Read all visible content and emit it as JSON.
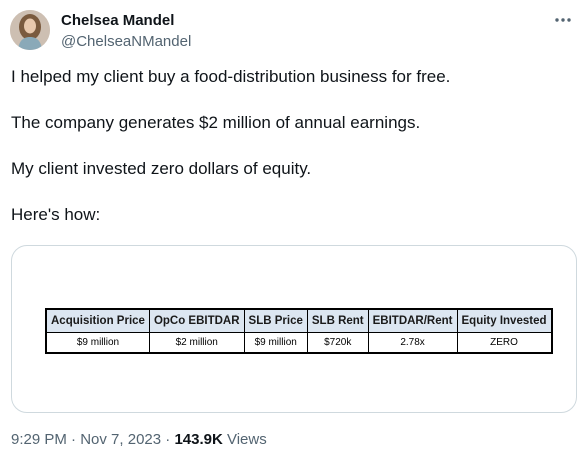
{
  "author": {
    "name": "Chelsea Mandel",
    "handle": "@ChelseaNMandel"
  },
  "icons": {
    "avatar": "profile-photo",
    "more": "more-icon"
  },
  "tweet": {
    "paragraphs": [
      "I helped my client buy a food-distribution business for free.",
      "The company generates $2 million of annual earnings.",
      "My client invested zero dollars of equity.",
      "Here's how:"
    ]
  },
  "table": {
    "headers": [
      "Acquisition Price",
      "OpCo EBITDAR",
      "SLB Price",
      "SLB Rent",
      "EBITDAR/Rent",
      "Equity Invested"
    ],
    "row": [
      "$9 million",
      "$2 million",
      "$9 million",
      "$720k",
      "2.78x",
      "ZERO"
    ]
  },
  "meta": {
    "time": "9:29 PM",
    "sep1": " · ",
    "date": "Nov 7, 2023",
    "sep2": " · ",
    "views_count": "143.9K",
    "views_label": " Views"
  },
  "colors": {
    "text": "#0f1419",
    "secondary": "#536471",
    "border": "#cfd9de",
    "table_header": "#dce6f1"
  }
}
